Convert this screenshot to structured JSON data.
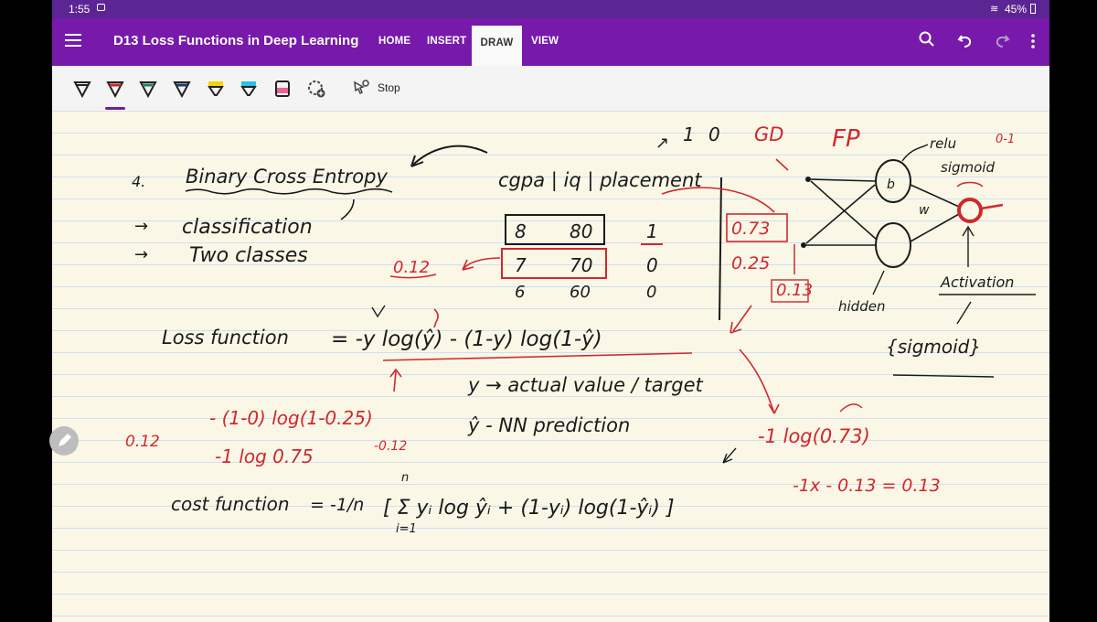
{
  "status": {
    "time": "1:55",
    "battery": "45%"
  },
  "app": {
    "title": "D13 Loss Functions in Deep Learning",
    "tabs": [
      "HOME",
      "INSERT",
      "DRAW",
      "VIEW"
    ],
    "active_tab": "DRAW"
  },
  "toolbar": {
    "pens": [
      {
        "name": "black-pen",
        "color": "#222222"
      },
      {
        "name": "red-pen",
        "color": "#c62828"
      },
      {
        "name": "green-pen",
        "color": "#2e7d5a"
      },
      {
        "name": "navy-pen",
        "color": "#1f3a68"
      },
      {
        "name": "yellow-highlighter",
        "color": "#f2d400"
      },
      {
        "name": "cyan-highlighter",
        "color": "#2bc0e4"
      },
      {
        "name": "pink-highlighter",
        "color": "#f06292"
      }
    ],
    "stop_label": "Stop",
    "accent": "#7719aa"
  },
  "notes": {
    "heading_number": "4.",
    "heading": "Binary Cross Entropy",
    "bullet1": "classification",
    "bullet2": "Two classes",
    "table_header": "cgpa | iq | placement",
    "rows": [
      {
        "cgpa": "8",
        "iq": "80",
        "placement": "1"
      },
      {
        "cgpa": "7",
        "iq": "70",
        "placement": "0"
      },
      {
        "cgpa": "6",
        "iq": "60",
        "placement": "0"
      }
    ],
    "row2_loss_note": "0.12",
    "top_notes": [
      "1",
      "0",
      "GD",
      "FP"
    ],
    "predictions": [
      "0.73",
      "0.25",
      "0.13"
    ],
    "nn_labels": {
      "relu": "relu",
      "sigmoid": "sigmoid",
      "range": "0-1",
      "b": "b",
      "w": "w",
      "hidden": "hidden",
      "activation": "Activation",
      "activation_fn": "{sigmoid}"
    },
    "loss_label": "Loss function",
    "loss_formula": "= -y log(ŷ) - (1-y) log(1-ŷ)",
    "y_def": "y → actual value / target",
    "yhat_def": "ŷ - NN prediction",
    "calc_line1": "- (1-0) log(1-0.25)",
    "calc_line2": "-1 log 0.75",
    "calc_result_left": "0.12",
    "calc_small": "-0.12",
    "calc_right1": "-1 log(0.73)",
    "calc_right2": "-1x - 0.13 = 0.13",
    "cost_label": "cost function",
    "cost_prefix": "= -1/n",
    "cost_sum_top": "n",
    "cost_sum_bottom": "i=1",
    "cost_formula": "[ Σ yᵢ log ŷᵢ + (1-yᵢ) log(1-ŷᵢ) ]"
  }
}
